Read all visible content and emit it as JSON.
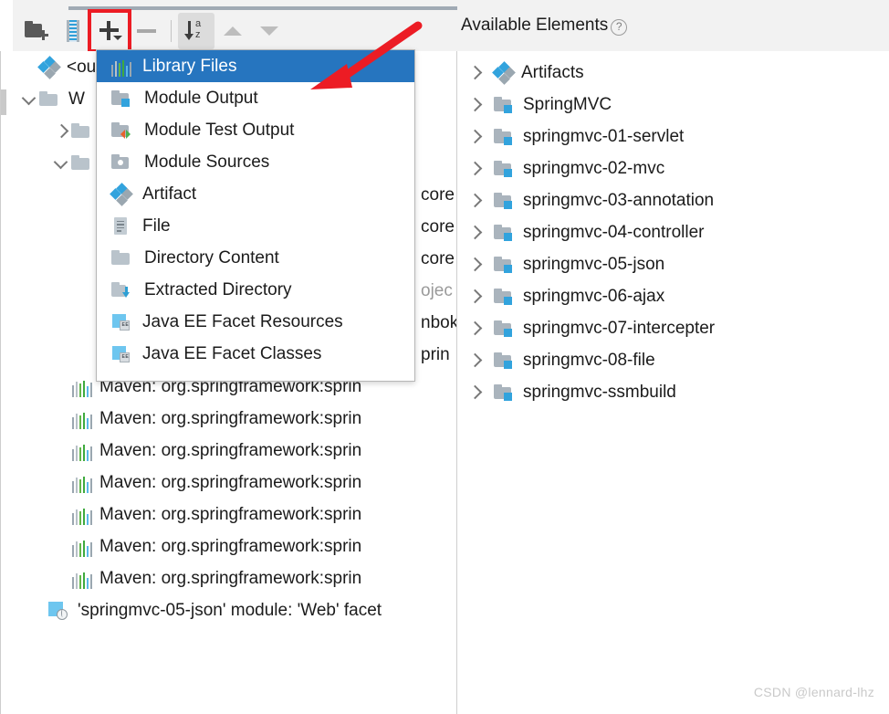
{
  "toolbar": {
    "buttons": [
      {
        "name": "add-content-root-button",
        "icon": "folder-add-icon",
        "label": ""
      },
      {
        "name": "add-jar-button",
        "icon": "jar-icon",
        "label": ""
      },
      {
        "name": "add-button",
        "icon": "plus-icon",
        "label": ""
      },
      {
        "name": "remove-button",
        "icon": "minus-icon",
        "label": ""
      },
      {
        "name": "sort-alphabetically-button",
        "icon": "sort-az-icon",
        "label": ""
      },
      {
        "name": "move-up-button",
        "icon": "triangle-up-icon",
        "label": ""
      },
      {
        "name": "move-down-button",
        "icon": "triangle-down-icon",
        "label": ""
      }
    ],
    "sort_letters_top": "a",
    "sort_letters_bottom": "z",
    "highlight_color": "#ec1c24"
  },
  "dropdown": {
    "name": "add-element-menu",
    "selected_index": 0,
    "items": [
      {
        "label": "Library Files",
        "icon": "library-bars-icon"
      },
      {
        "label": "Module Output",
        "icon": "module-output-icon"
      },
      {
        "label": "Module Test Output",
        "icon": "module-test-output-icon"
      },
      {
        "label": "Module Sources",
        "icon": "module-sources-icon"
      },
      {
        "label": "Artifact",
        "icon": "artifact-icon"
      },
      {
        "label": "File",
        "icon": "file-icon"
      },
      {
        "label": "Directory Content",
        "icon": "folder-icon"
      },
      {
        "label": "Extracted Directory",
        "icon": "extracted-directory-icon"
      },
      {
        "label": "Java EE Facet Resources",
        "icon": "java-ee-facet-icon"
      },
      {
        "label": "Java EE Facet Classes",
        "icon": "java-ee-facet-icon"
      }
    ]
  },
  "left_tree": {
    "rows": [
      {
        "label": "<out",
        "icon": "artifact-icon",
        "chevron": "none",
        "indent": 20,
        "muted": false
      },
      {
        "label": "W",
        "icon": "folder-icon",
        "chevron": "down",
        "indent": 20,
        "muted": false
      },
      {
        "label": "",
        "icon": "folder-icon",
        "chevron": "right",
        "indent": 55,
        "muted": false
      },
      {
        "label": "",
        "icon": "folder-icon",
        "chevron": "down",
        "indent": 55,
        "muted": false
      },
      {
        "label": "core",
        "icon": "none",
        "chevron": "none",
        "indent": 452,
        "muted": false
      },
      {
        "label": "core",
        "icon": "none",
        "chevron": "none",
        "indent": 452,
        "muted": false
      },
      {
        "label": "core",
        "icon": "none",
        "chevron": "none",
        "indent": 452,
        "muted": false
      },
      {
        "label": "ojec",
        "icon": "none",
        "chevron": "none",
        "indent": 452,
        "muted": true
      },
      {
        "label": "nbok",
        "icon": "none",
        "chevron": "none",
        "indent": 452,
        "muted": false
      },
      {
        "label": "prin",
        "icon": "none",
        "chevron": "none",
        "indent": 452,
        "muted": false
      }
    ],
    "maven_rows": [
      "Maven: org.springframework:sprin",
      "Maven: org.springframework:sprin",
      "Maven: org.springframework:sprin",
      "Maven: org.springframework:sprin",
      "Maven: org.springframework:sprin",
      "Maven: org.springframework:sprin",
      "Maven: org.springframework:sprin"
    ],
    "maven_icon": "library-bars-icon",
    "facet_row": {
      "label": "'springmvc-05-json' module: 'Web' facet",
      "icon": "web-facet-icon"
    }
  },
  "right_panel": {
    "title": "Available Elements",
    "help_icon": "?",
    "items": [
      {
        "label": "Artifacts",
        "icon": "artifact-icon"
      },
      {
        "label": "SpringMVC",
        "icon": "module-icon"
      },
      {
        "label": "springmvc-01-servlet",
        "icon": "module-icon"
      },
      {
        "label": "springmvc-02-mvc",
        "icon": "module-icon"
      },
      {
        "label": "springmvc-03-annotation",
        "icon": "module-icon"
      },
      {
        "label": "springmvc-04-controller",
        "icon": "module-icon"
      },
      {
        "label": "springmvc-05-json",
        "icon": "module-icon"
      },
      {
        "label": "springmvc-06-ajax",
        "icon": "module-icon"
      },
      {
        "label": "springmvc-07-intercepter",
        "icon": "module-icon"
      },
      {
        "label": "springmvc-08-file",
        "icon": "module-icon"
      },
      {
        "label": "springmvc-ssmbuild",
        "icon": "module-icon"
      }
    ]
  },
  "watermark": "CSDN @lennard-lhz"
}
